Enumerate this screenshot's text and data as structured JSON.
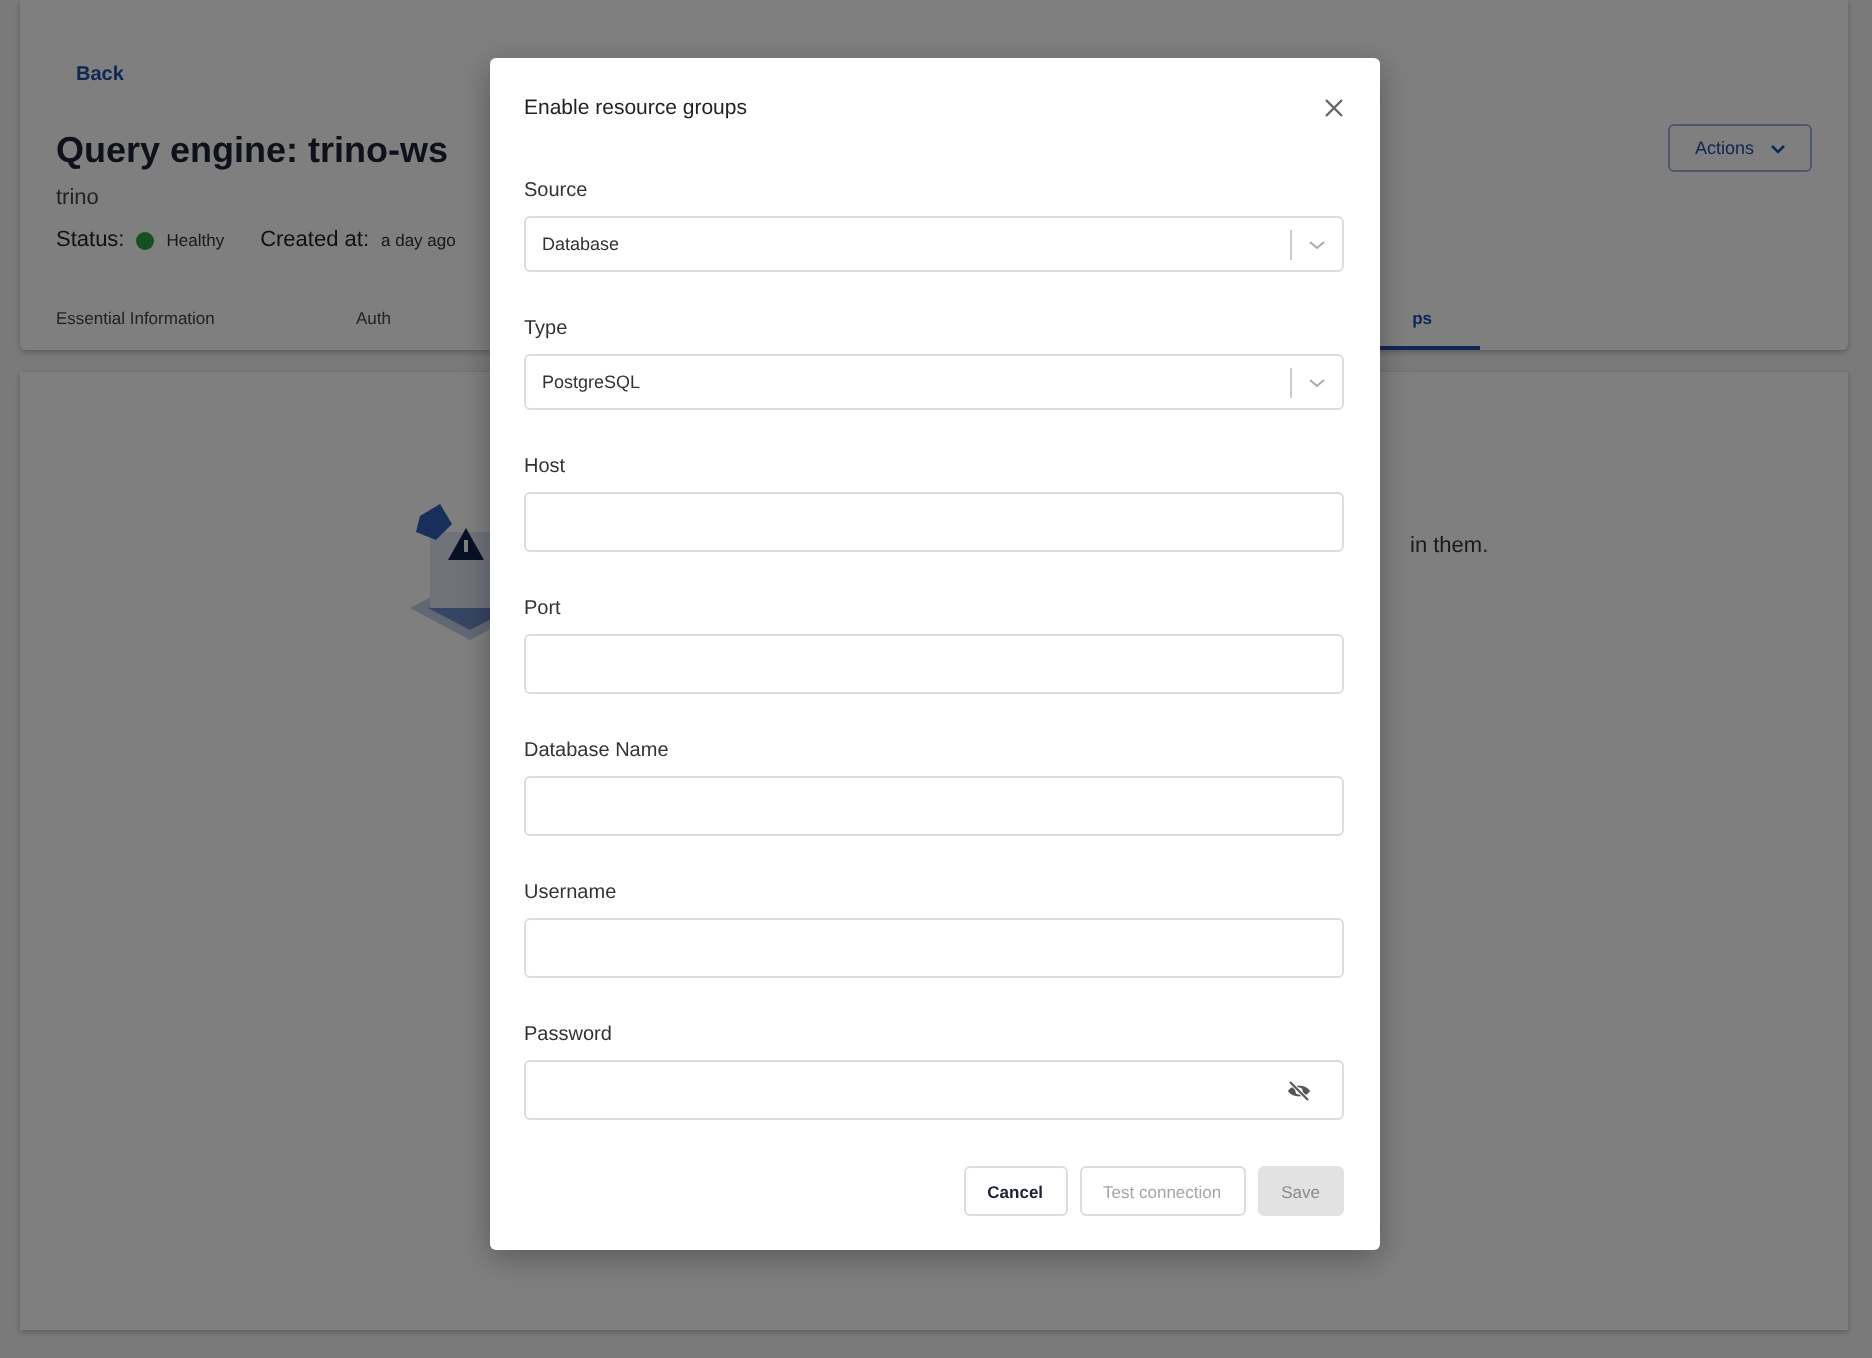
{
  "header": {
    "back_link": "Back",
    "title": "Query engine: trino-ws",
    "subtitle": "trino",
    "status_label": "Status:",
    "status_value": "Healthy",
    "created_label": "Created at:",
    "created_value": "a day ago",
    "actions_button": "Actions"
  },
  "tabs": [
    {
      "label": "Essential Information",
      "selected": false
    },
    {
      "label": "Auth",
      "selected": false
    },
    {
      "label": "ps",
      "selected": true
    }
  ],
  "empty_state": {
    "text": "in them."
  },
  "dialog": {
    "title": "Enable resource groups",
    "fields": [
      {
        "kind": "select",
        "label": "Source",
        "value": "Database"
      },
      {
        "kind": "select",
        "label": "Type",
        "value": "PostgreSQL"
      },
      {
        "kind": "text",
        "label": "Host"
      },
      {
        "kind": "text",
        "label": "Port"
      },
      {
        "kind": "text",
        "label": "Database Name"
      },
      {
        "kind": "text",
        "label": "Username"
      },
      {
        "kind": "password",
        "label": "Password"
      }
    ],
    "buttons": [
      {
        "label": "Cancel",
        "kind": "outline",
        "disabled": false
      },
      {
        "label": "Test connection",
        "kind": "outline",
        "disabled": true
      },
      {
        "label": "Save",
        "kind": "primary",
        "disabled": true
      }
    ]
  }
}
